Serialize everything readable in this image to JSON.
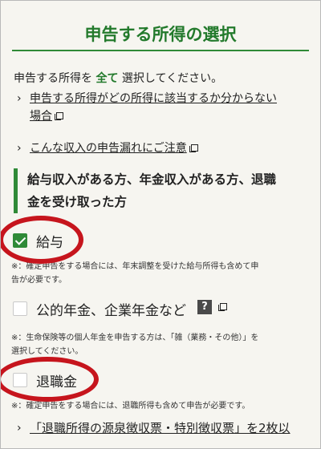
{
  "header": {
    "title": "申告する所得の選択"
  },
  "intro": {
    "prefix": "申告する所得を",
    "emphasis": "全て",
    "suffix": "選択してください。"
  },
  "icons": {
    "chevron": "›",
    "help": "?",
    "external": "external-link-icon"
  },
  "links": [
    {
      "line1": "申告する所得がどの所得に該当するか分からない",
      "line2": "場合"
    },
    {
      "label": "こんな収入の申告漏れにご注意"
    },
    {
      "label": "「退職所得の源泉徴収票・特別徴収票」を2枚以"
    }
  ],
  "section": {
    "heading_line1": "給与収入がある方、年金収入がある方、退職",
    "heading_line2": "金を受け取った方"
  },
  "options": [
    {
      "label": "給与",
      "checked": true,
      "note_line1": "※：確定申告をする場合には、年末調整を受けた給与所得も含めて申",
      "note_line2": "告が必要です。"
    },
    {
      "label": "公的年金、企業年金など",
      "checked": false,
      "note_line1": "※：生命保険等の個人年金を申告する方は、「雑（業務・その他）」を",
      "note_line2": "選択してください。"
    },
    {
      "label": "退職金",
      "checked": false,
      "note": "※：確定申告をする場合には、退職所得も含めて申告が必要です。"
    }
  ],
  "colors": {
    "accent": "#237a2c",
    "annotation": "#c6151d",
    "background": "#f6f5f0"
  }
}
